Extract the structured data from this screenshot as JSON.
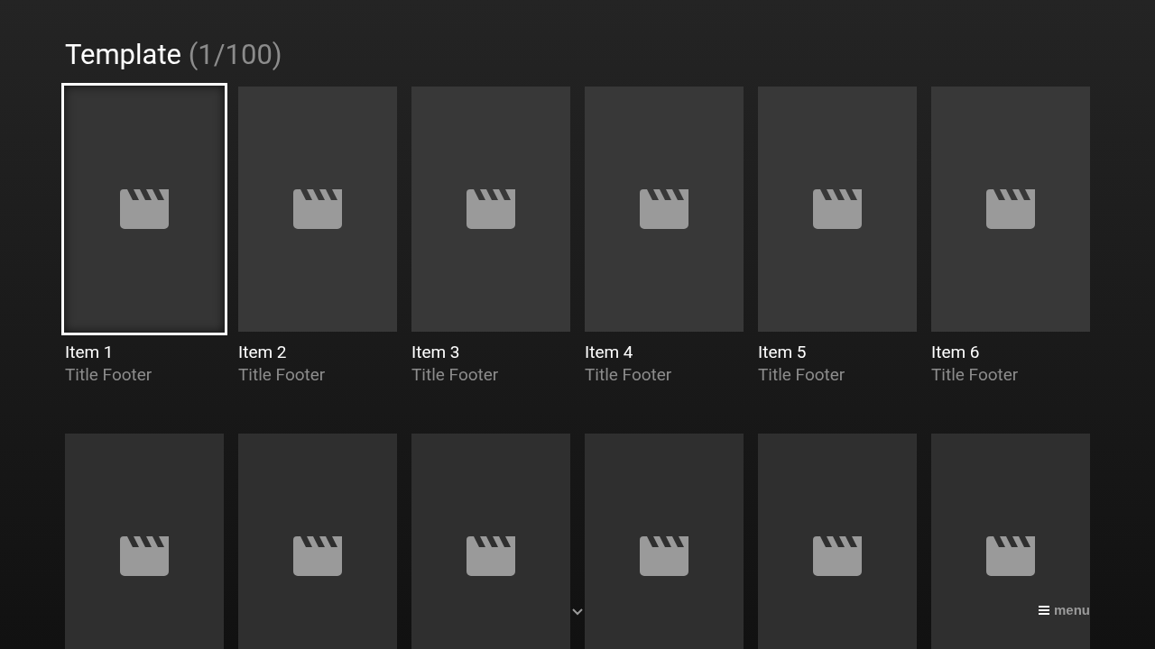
{
  "header": {
    "title": "Template",
    "count": "(1/100)"
  },
  "rows": [
    {
      "items": [
        {
          "title": "Item 1",
          "footer": "Title Footer",
          "selected": true
        },
        {
          "title": "Item 2",
          "footer": "Title Footer",
          "selected": false
        },
        {
          "title": "Item 3",
          "footer": "Title Footer",
          "selected": false
        },
        {
          "title": "Item 4",
          "footer": "Title Footer",
          "selected": false
        },
        {
          "title": "Item 5",
          "footer": "Title Footer",
          "selected": false
        },
        {
          "title": "Item 6",
          "footer": "Title Footer",
          "selected": false
        }
      ]
    },
    {
      "items": [
        {
          "selected": false
        },
        {
          "selected": false
        },
        {
          "selected": false
        },
        {
          "selected": false
        },
        {
          "selected": false
        },
        {
          "selected": false
        }
      ]
    }
  ],
  "menu": {
    "label": "menu"
  }
}
